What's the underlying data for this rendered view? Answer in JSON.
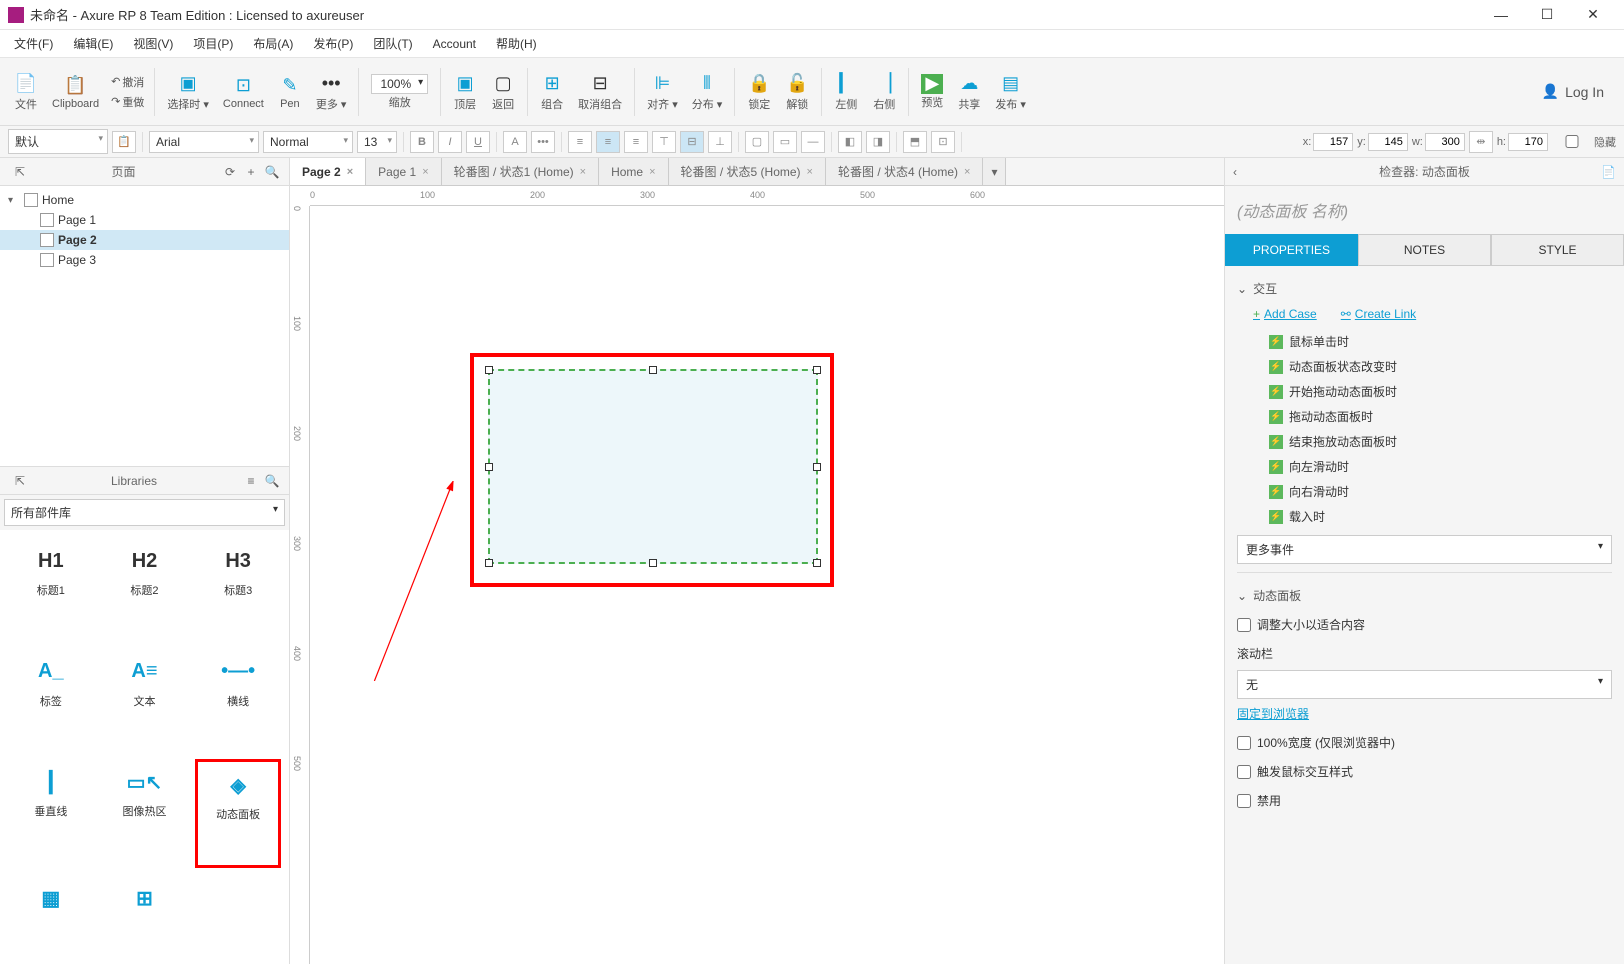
{
  "window": {
    "title": "未命名 - Axure RP 8 Team Edition : Licensed to axureuser"
  },
  "menubar": {
    "items": [
      "文件(F)",
      "编辑(E)",
      "视图(V)",
      "项目(P)",
      "布局(A)",
      "发布(P)",
      "团队(T)",
      "Account",
      "帮助(H)"
    ]
  },
  "toolbar": {
    "file": "文件",
    "clipboard": "Clipboard",
    "undo": "撤消",
    "redo": "重做",
    "select_mode": "选择时",
    "connect": "Connect",
    "pen": "Pen",
    "more": "更多",
    "zoom_value": "100%",
    "zoom_label": "缩放",
    "front": "顶层",
    "back": "返回",
    "group": "组合",
    "ungroup": "取消组合",
    "align": "对齐",
    "distribute": "分布",
    "lock": "锁定",
    "unlock": "解锁",
    "left": "左侧",
    "right": "右侧",
    "preview": "预览",
    "share": "共享",
    "publish": "发布",
    "login": "Log In"
  },
  "formatbar": {
    "style_select": "默认",
    "font": "Arial",
    "weight": "Normal",
    "size": "13",
    "coords": {
      "x_label": "x:",
      "x": "157",
      "y_label": "y:",
      "y": "145",
      "w_label": "w:",
      "w": "300",
      "h_label": "h:",
      "h": "170",
      "hide": "隐藏"
    }
  },
  "pages_panel": {
    "title": "页面",
    "tree": [
      {
        "label": "Home",
        "depth": 0,
        "expanded": true
      },
      {
        "label": "Page 1",
        "depth": 1
      },
      {
        "label": "Page 2",
        "depth": 1,
        "selected": true
      },
      {
        "label": "Page 3",
        "depth": 1
      }
    ]
  },
  "libraries_panel": {
    "title": "Libraries",
    "dropdown": "所有部件库",
    "widgets": [
      {
        "icon": "H1",
        "label": "标题1"
      },
      {
        "icon": "H2",
        "label": "标题2"
      },
      {
        "icon": "H3",
        "label": "标题3"
      },
      {
        "icon": "A_",
        "label": "标签"
      },
      {
        "icon": "A≡",
        "label": "文本"
      },
      {
        "icon": "—",
        "label": "横线"
      },
      {
        "icon": "|",
        "label": "垂直线"
      },
      {
        "icon": "▭",
        "label": "图像热区"
      },
      {
        "icon": "◆",
        "label": "动态面板",
        "highlight": true
      }
    ]
  },
  "tabs": [
    {
      "label": "Page 2",
      "active": true
    },
    {
      "label": "Page 1"
    },
    {
      "label": "轮番图 / 状态1 (Home)"
    },
    {
      "label": "Home"
    },
    {
      "label": "轮番图 / 状态5 (Home)"
    },
    {
      "label": "轮番图 / 状态4 (Home)"
    }
  ],
  "ruler_h": [
    "0",
    "100",
    "200",
    "300",
    "400",
    "500",
    "600"
  ],
  "ruler_v": [
    "0",
    "100",
    "200",
    "300",
    "400",
    "500"
  ],
  "inspector": {
    "header": "检查器: 动态面板",
    "name_placeholder": "(动态面板 名称)",
    "tabs": {
      "properties": "PROPERTIES",
      "notes": "NOTES",
      "style": "STYLE"
    },
    "section_interactions": "交互",
    "add_case": "Add Case",
    "create_link": "Create Link",
    "events": [
      "鼠标单击时",
      "动态面板状态改变时",
      "开始拖动动态面板时",
      "拖动动态面板时",
      "结束拖放动态面板时",
      "向左滑动时",
      "向右滑动时",
      "载入时"
    ],
    "more_events": "更多事件",
    "section_dp": "动态面板",
    "fit_content": "调整大小以适合内容",
    "scrollbar_label": "滚动栏",
    "scrollbar_value": "无",
    "pin_browser": "固定到浏览器",
    "width_100": "100%宽度 (仅限浏览器中)",
    "trigger_mouse": "触发鼠标交互样式",
    "disabled": "禁用"
  }
}
